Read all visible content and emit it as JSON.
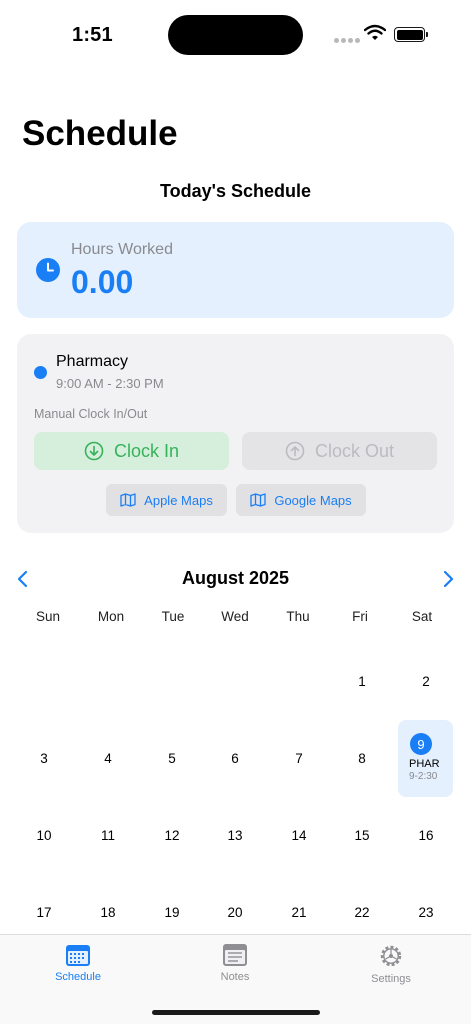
{
  "status_bar": {
    "time": "1:51"
  },
  "page": {
    "title": "Schedule",
    "section_title": "Today's Schedule"
  },
  "hours": {
    "label": "Hours Worked",
    "value": "0.00"
  },
  "shift": {
    "name": "Pharmacy",
    "time": "9:00 AM - 2:30 PM",
    "manual_label": "Manual Clock In/Out",
    "clock_in_label": "Clock In",
    "clock_out_label": "Clock Out",
    "apple_maps_label": "Apple Maps",
    "google_maps_label": "Google Maps"
  },
  "calendar": {
    "month": "August 2025",
    "weekdays": [
      "Sun",
      "Mon",
      "Tue",
      "Wed",
      "Thu",
      "Fri",
      "Sat"
    ],
    "days": [
      "1",
      "2",
      "3",
      "4",
      "5",
      "6",
      "7",
      "8",
      "9",
      "10",
      "11",
      "12",
      "13",
      "14",
      "15",
      "16",
      "17",
      "18",
      "19",
      "20",
      "21",
      "22",
      "23"
    ],
    "selected": {
      "day": "9",
      "code": "PHAR",
      "time": "9-2:30"
    }
  },
  "tabs": [
    {
      "label": "Schedule"
    },
    {
      "label": "Notes"
    },
    {
      "label": "Settings"
    }
  ],
  "colors": {
    "accent": "#1a7ef5",
    "success": "#38b25a",
    "card_blue": "#e4f0fe"
  }
}
